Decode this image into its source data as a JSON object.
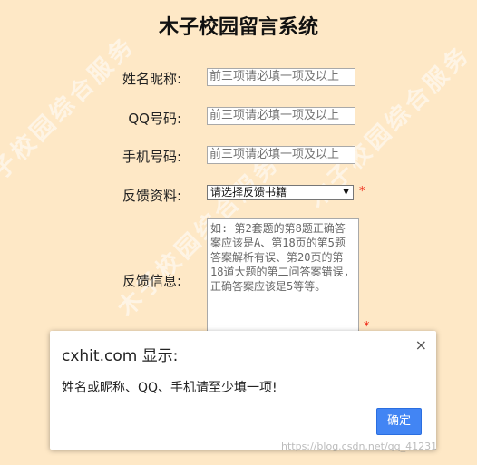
{
  "page": {
    "title": "木子校园留言系统",
    "watermark": [
      "木子校园综合服务",
      "木子校园综合服务",
      "木子校园综合服务"
    ]
  },
  "form": {
    "nickname": {
      "label": "姓名昵称:",
      "placeholder": "前三项请必填一项及以上"
    },
    "qq": {
      "label": "QQ号码:",
      "placeholder": "前三项请必填一项及以上"
    },
    "phone": {
      "label": "手机号码:",
      "placeholder": "前三项请必填一项及以上"
    },
    "feedback_material": {
      "label": "反馈资料:",
      "selected": "请选择反馈书籍",
      "required_mark": "*"
    },
    "feedback_info": {
      "label": "反馈信息:",
      "placeholder": "如: 第2套题的第8题正确答案应该是A、第18页的第5题答案解析有误、第20页的第18道大题的第二问答案错误, 正确答案应该是5等等。",
      "required_mark": "*"
    }
  },
  "dialog": {
    "host": "cxhit.com 显示:",
    "message": "姓名或昵称、QQ、手机请至少填一项!",
    "close_glyph": "×",
    "ok_label": "确定"
  },
  "footer": {
    "url_watermark": "https://blog.csdn.net/qq_41231"
  },
  "colors": {
    "background": "#fee8c6",
    "accent": "#4285f4",
    "required": "#e21111"
  }
}
